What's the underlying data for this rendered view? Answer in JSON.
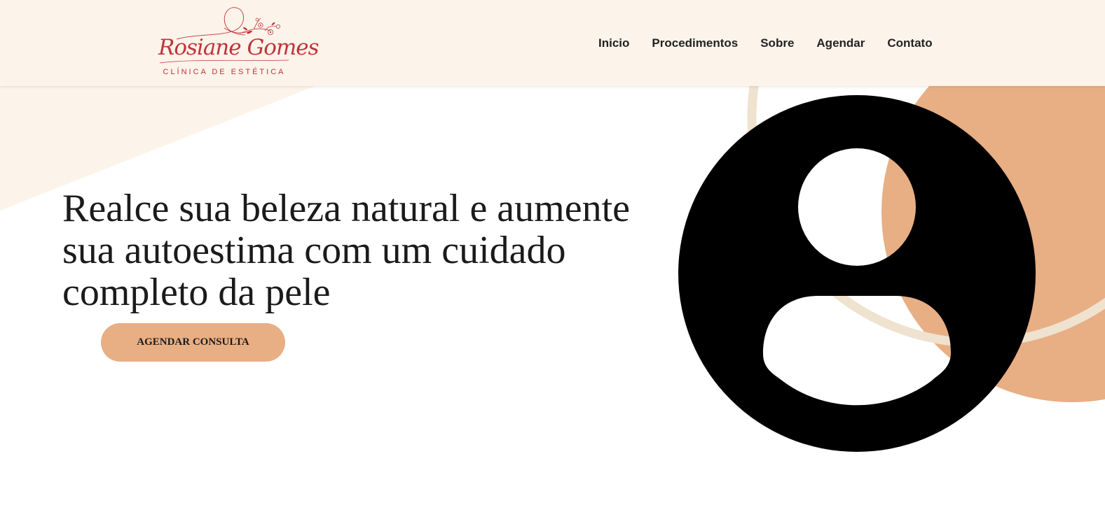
{
  "brand": {
    "name_script": "Rosiane Gomes",
    "subtitle": "CLÍNICA DE ESTÉTICA",
    "color": "#c0343a"
  },
  "nav": {
    "items": [
      {
        "label": "Inicio"
      },
      {
        "label": "Procedimentos"
      },
      {
        "label": "Sobre"
      },
      {
        "label": "Agendar"
      },
      {
        "label": "Contato"
      }
    ]
  },
  "hero": {
    "heading": "Realce sua beleza natural e aumente sua autoestima com um cuidado completo da pele",
    "cta_label": "AGENDAR CONSULTA",
    "image_icon": "user-avatar-placeholder-icon"
  },
  "colors": {
    "header_bg": "#fcf3ea",
    "accent": "#e8ae84",
    "cream": "#efe2cf",
    "text": "#1b1b1b"
  }
}
